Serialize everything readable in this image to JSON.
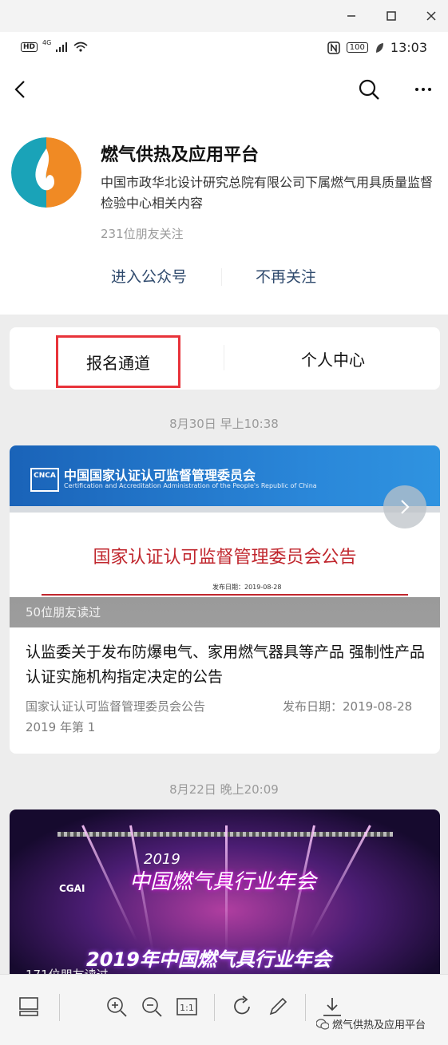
{
  "status_bar": {
    "hd": "HD",
    "signal_label": "4G",
    "battery": "100",
    "time": "13:03"
  },
  "account": {
    "name": "燃气供热及应用平台",
    "description": "中国市政华北设计研究总院有限公司下属燃气用具质量监督检验中心相关内容",
    "followers": "231位朋友关注",
    "enter_label": "进入公众号",
    "unfollow_label": "不再关注",
    "logo_colors": {
      "teal": "#1aa3b8",
      "orange": "#f08a24"
    }
  },
  "menu": {
    "items": [
      {
        "label": "报名通道"
      },
      {
        "label": "个人中心"
      }
    ],
    "highlight_color": "#e8333a"
  },
  "articles": [
    {
      "date": "8月30日 早上10:38",
      "cover": {
        "org_logo": "CNCA",
        "org_cn": "中国国家认证认可监督管理委员会",
        "org_en": "Certification and Accreditation Administration of the People's Republic of China",
        "notice_title": "国家认证认可监督管理委员会公告",
        "publish_date": "发布日期：2019-08-28"
      },
      "readers": "50位朋友读过",
      "title": "认监委关于发布防爆电气、家用燃气器具等产品 强制性产品认证实施机构指定决定的公告",
      "digest_left": "国家认证认可监督管理委员会公告",
      "digest_right": "发布日期：2019-08-28",
      "digest_line2": "2019 年第 1"
    },
    {
      "date": "8月22日 晚上20:09",
      "cover": {
        "year": "2019",
        "stage_title": "中国燃气具行业年会",
        "banner": "2019年中国燃气具行业年会",
        "brand": "CGAI"
      },
      "readers": "171位朋友读过"
    }
  ],
  "watermark": "燃气供热及应用平台",
  "icons": [
    "minimize-icon",
    "maximize-icon",
    "close-icon",
    "back-icon",
    "search-icon",
    "more-icon",
    "next-arrow-icon",
    "pages-icon",
    "zoom-in-icon",
    "zoom-out-icon",
    "actual-size-icon",
    "rotate-icon",
    "edit-icon",
    "download-icon",
    "wechat-icon"
  ]
}
